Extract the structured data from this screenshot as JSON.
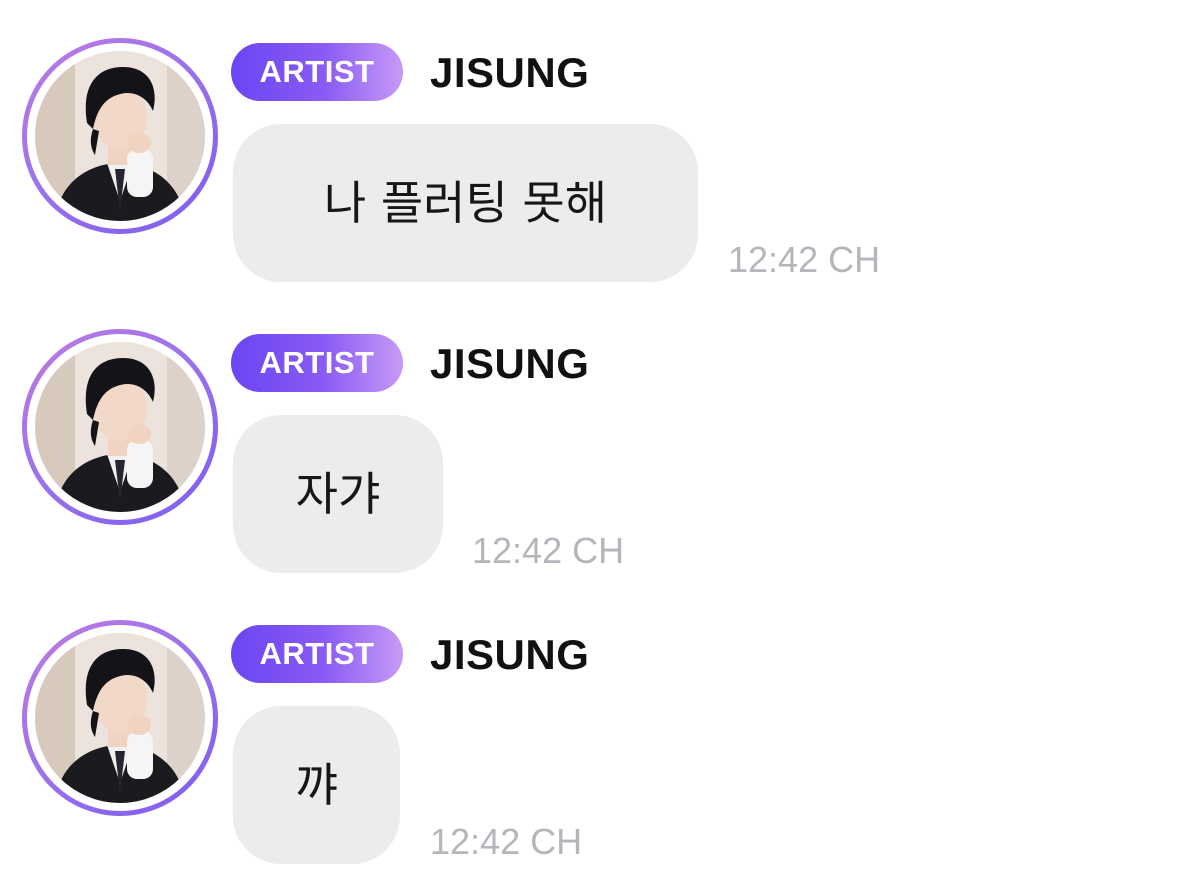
{
  "messages": [
    {
      "badge": "ARTIST",
      "sender": "JISUNG",
      "text": "나 플러팅 못해",
      "time": "12:42 CH"
    },
    {
      "badge": "ARTIST",
      "sender": "JISUNG",
      "text": "자갸",
      "time": "12:42 CH"
    },
    {
      "badge": "ARTIST",
      "sender": "JISUNG",
      "text": "꺄",
      "time": "12:42 CH"
    }
  ],
  "colors": {
    "badge_gradient_start": "#6a45f2",
    "badge_gradient_end": "#c79af7",
    "avatar_ring": "#9b73ec",
    "bubble_background": "#ececef",
    "timestamp": "#b5b5bb"
  },
  "icons": {
    "avatar": "artist-profile-photo"
  }
}
